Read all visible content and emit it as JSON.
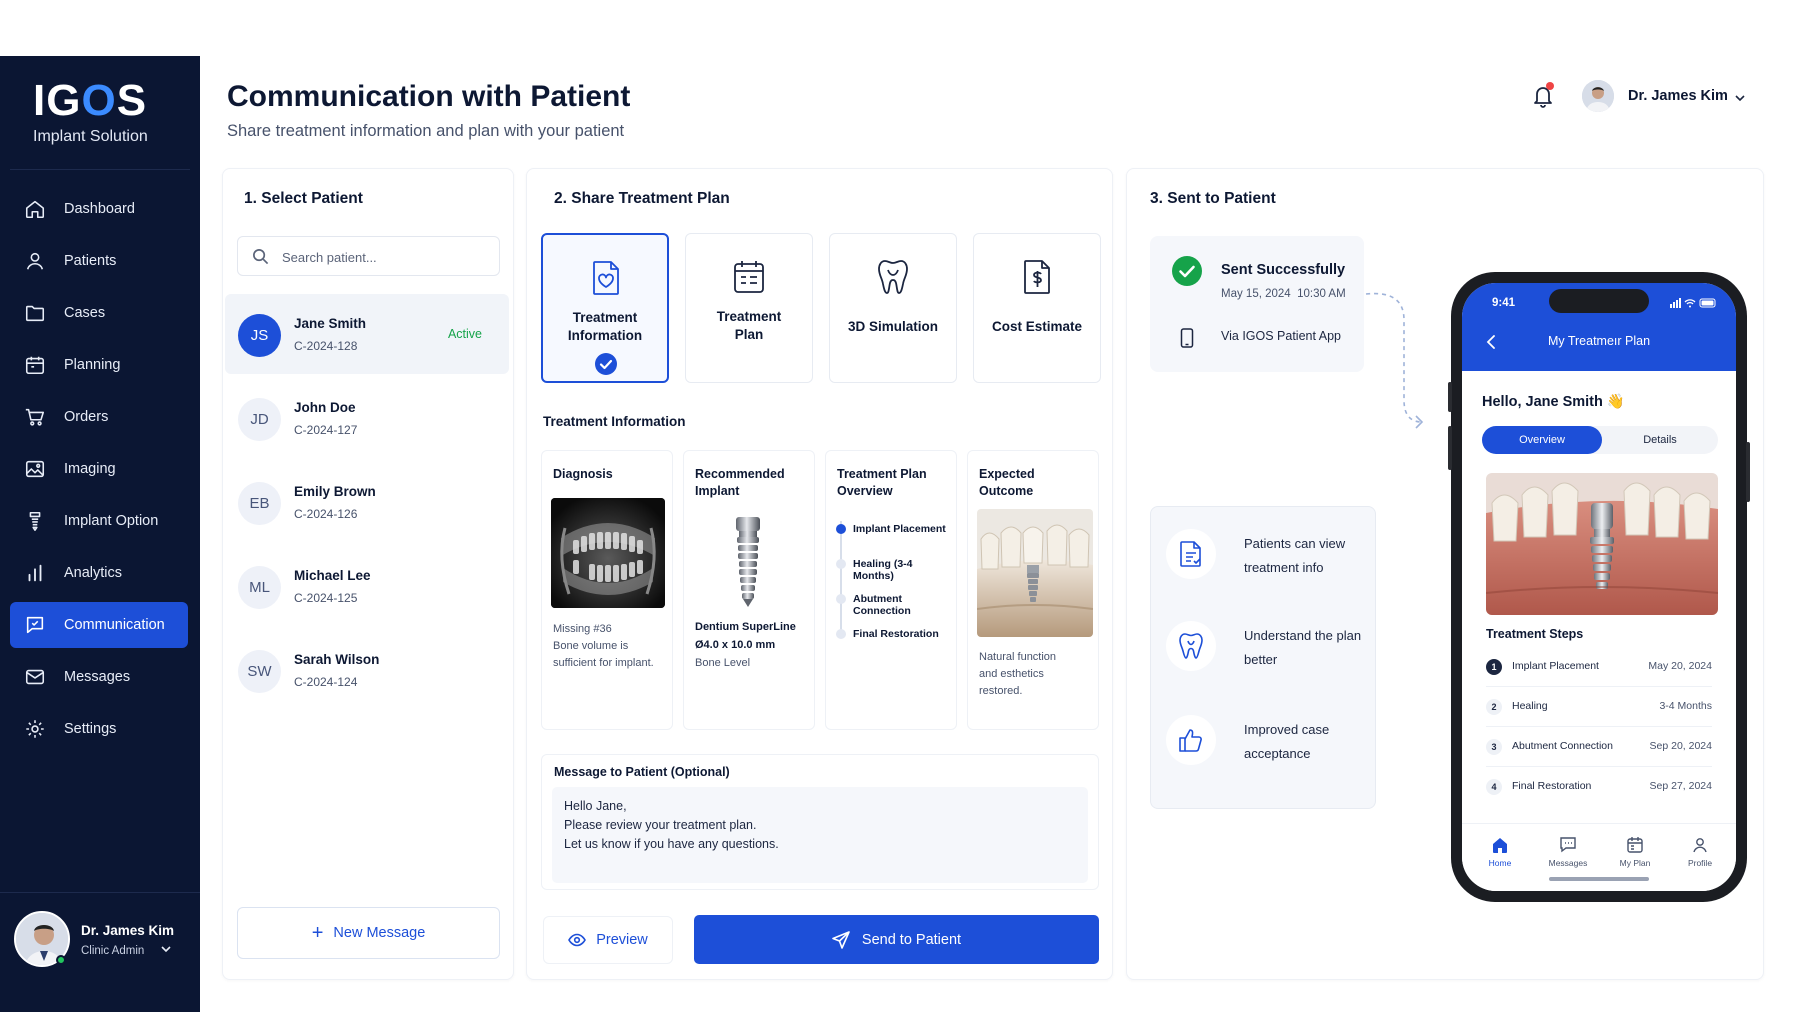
{
  "app": {
    "logo": {
      "prefix": "IG",
      "o": "O",
      "suffix": "S"
    },
    "logo_subtitle": "Implant Solution"
  },
  "sidebar": {
    "items": [
      {
        "label": "Dashboard",
        "icon": "home-icon"
      },
      {
        "label": "Patients",
        "icon": "user-icon"
      },
      {
        "label": "Cases",
        "icon": "folder-icon"
      },
      {
        "label": "Planning",
        "icon": "calendar-icon"
      },
      {
        "label": "Orders",
        "icon": "cart-icon"
      },
      {
        "label": "Imaging",
        "icon": "image-icon"
      },
      {
        "label": "Implant Option",
        "icon": "implant-icon"
      },
      {
        "label": "Analytics",
        "icon": "bar-chart-icon"
      },
      {
        "label": "Communication",
        "icon": "chat-icon",
        "active": true
      },
      {
        "label": "Messages",
        "icon": "mail-icon"
      },
      {
        "label": "Settings",
        "icon": "gear-icon"
      }
    ],
    "user": {
      "name": "Dr. James Kim",
      "role": "Clinic Admin"
    }
  },
  "header": {
    "title": "Communication with Patient",
    "subtitle": "Share treatment information and plan with your patient",
    "user_name": "Dr. James Kim"
  },
  "select_patient": {
    "title": "1. Select Patient",
    "search_placeholder": "Search patient...",
    "patients": [
      {
        "initials": "JS",
        "name": "Jane Smith",
        "id": "C-2024-128",
        "status": "Active"
      },
      {
        "initials": "JD",
        "name": "John Doe",
        "id": "C-2024-127",
        "status": ""
      },
      {
        "initials": "EB",
        "name": "Emily Brown",
        "id": "C-2024-126",
        "status": ""
      },
      {
        "initials": "ML",
        "name": "Michael Lee",
        "id": "C-2024-125",
        "status": ""
      },
      {
        "initials": "SW",
        "name": "Sarah Wilson",
        "id": "C-2024-124",
        "status": ""
      }
    ],
    "new_message_label": "New Message"
  },
  "share_plan": {
    "title": "2. Share Treatment Plan",
    "options": [
      {
        "label_1": "Treatment",
        "label_2": "Information",
        "icon": "heart-document-icon",
        "selected": true
      },
      {
        "label_1": "Treatment",
        "label_2": "Plan",
        "icon": "calendar-list-icon",
        "selected": false
      },
      {
        "label_1": "3D Simulation",
        "label_2": "",
        "icon": "tooth-icon",
        "selected": false
      },
      {
        "label_1": "Cost Estimate",
        "label_2": "",
        "icon": "dollar-document-icon",
        "selected": false
      }
    ],
    "section_label": "Treatment Information",
    "diagnosis": {
      "title": "Diagnosis",
      "lines": [
        "Missing #36",
        "Bone volume is",
        "sufficient for implant."
      ]
    },
    "implant": {
      "title_1": "Recommended",
      "title_2": "Implant",
      "name": "Dentium SuperLine",
      "size": "Ø4.0 x 10.0 mm",
      "level": "Bone Level"
    },
    "overview": {
      "title_1": "Treatment Plan",
      "title_2": "Overview",
      "steps": [
        "Implant Placement",
        "Healing (3-4 Months)",
        "Abutment Connection",
        "Final Restoration"
      ]
    },
    "outcome": {
      "title": "Expected Outcome",
      "lines": [
        "Natural function",
        "and esthetics",
        "restored."
      ]
    },
    "message": {
      "label": "Message to Patient (Optional)",
      "lines": [
        "Hello Jane,",
        "Please review your treatment plan.",
        "Let us know if you have any questions."
      ]
    },
    "preview_label": "Preview",
    "send_label": "Send to Patient"
  },
  "sent": {
    "title": "3. Sent to Patient",
    "status": "Sent Successfully",
    "date": "May 15, 2024",
    "time": "10:30 AM",
    "via": "Via IGOS Patient App",
    "benefits": [
      {
        "line_1": "Patients can view",
        "line_2": "treatment info",
        "icon": "document-icon"
      },
      {
        "line_1": "Understand the plan",
        "line_2": "better",
        "icon": "tooth-icon"
      },
      {
        "line_1": "Improved case",
        "line_2": "acceptance",
        "icon": "thumbs-up-icon"
      }
    ]
  },
  "phone": {
    "time": "9:41",
    "title": "My Treatmeır Plan",
    "greeting": "Hello, Jane Smith 👋",
    "tab_on": "Overview",
    "tab_off": "Details",
    "steps_title": "Treatment Steps",
    "steps": [
      {
        "num": "1",
        "name": "Implant Placement",
        "date": "May 20, 2024"
      },
      {
        "num": "2",
        "name": "Healing",
        "date": "3-4 Months"
      },
      {
        "num": "3",
        "name": "Abutment Connection",
        "date": "Sep 20, 2024"
      },
      {
        "num": "4",
        "name": "Final Restoration",
        "date": "Sep 27, 2024"
      }
    ],
    "tabbar": [
      {
        "label": "Home",
        "icon": "home-icon"
      },
      {
        "label": "Messages",
        "icon": "chat-icon"
      },
      {
        "label": "My Plan",
        "icon": "calendar-icon"
      },
      {
        "label": "Profile",
        "icon": "user-icon"
      }
    ]
  },
  "colors": {
    "sidebar_bg": "#0b1633",
    "accent": "#1d4fd8",
    "success": "#16a34a",
    "alert": "#ef4444"
  }
}
